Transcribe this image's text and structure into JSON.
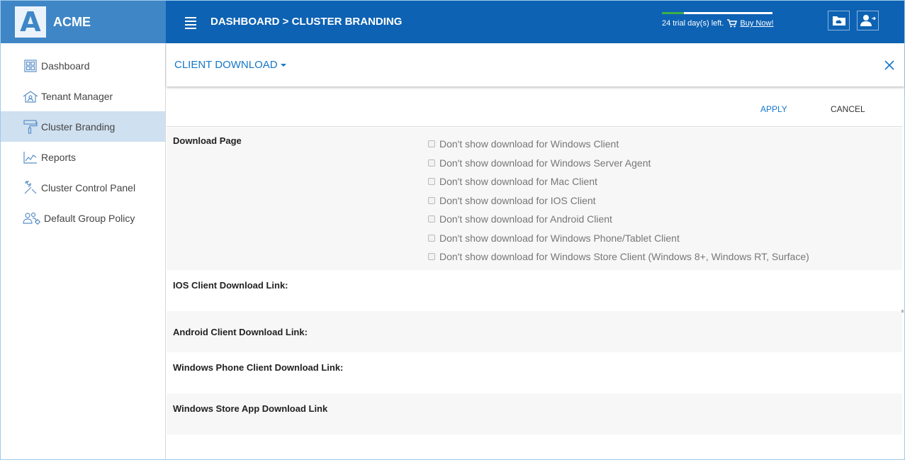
{
  "brand": {
    "logo_letter": "A",
    "name": "ACME"
  },
  "header": {
    "breadcrumb": "DASHBOARD > CLUSTER BRANDING",
    "trial_text": "24 trial day(s) left.",
    "buy_now": "Buy Now!",
    "trial_progress": 0.2,
    "colors": {
      "bar": "#0d62b3",
      "brand": "#3f86c6",
      "trial_fill": "#3dae49"
    }
  },
  "sidebar": {
    "items": [
      {
        "label": "Dashboard",
        "icon": "dashboard-grid-icon"
      },
      {
        "label": "Tenant Manager",
        "icon": "tenant-house-icon"
      },
      {
        "label": "Cluster Branding",
        "icon": "paint-roller-icon",
        "active": true
      },
      {
        "label": "Reports",
        "icon": "chart-line-icon"
      },
      {
        "label": "Cluster Control Panel",
        "icon": "tools-icon"
      },
      {
        "label": "Default Group Policy",
        "icon": "group-gear-icon"
      }
    ]
  },
  "panel": {
    "title": "CLIENT DOWNLOAD",
    "apply": "APPLY",
    "cancel": "CANCEL",
    "download_page_label": "Download Page",
    "checkboxes": [
      "Don't show download for Windows Client",
      "Don't show download for Windows Server Agent",
      "Don't show download for Mac Client",
      "Don't show download for IOS Client",
      "Don't show download for Android Client",
      "Don't show download for Windows Phone/Tablet Client",
      "Don't show download for Windows Store Client (Windows 8+, Windows RT, Surface)"
    ],
    "links": [
      "IOS Client Download Link:",
      "Android Client Download Link:",
      "Windows Phone Client Download Link:",
      "Windows Store App Download Link"
    ]
  }
}
